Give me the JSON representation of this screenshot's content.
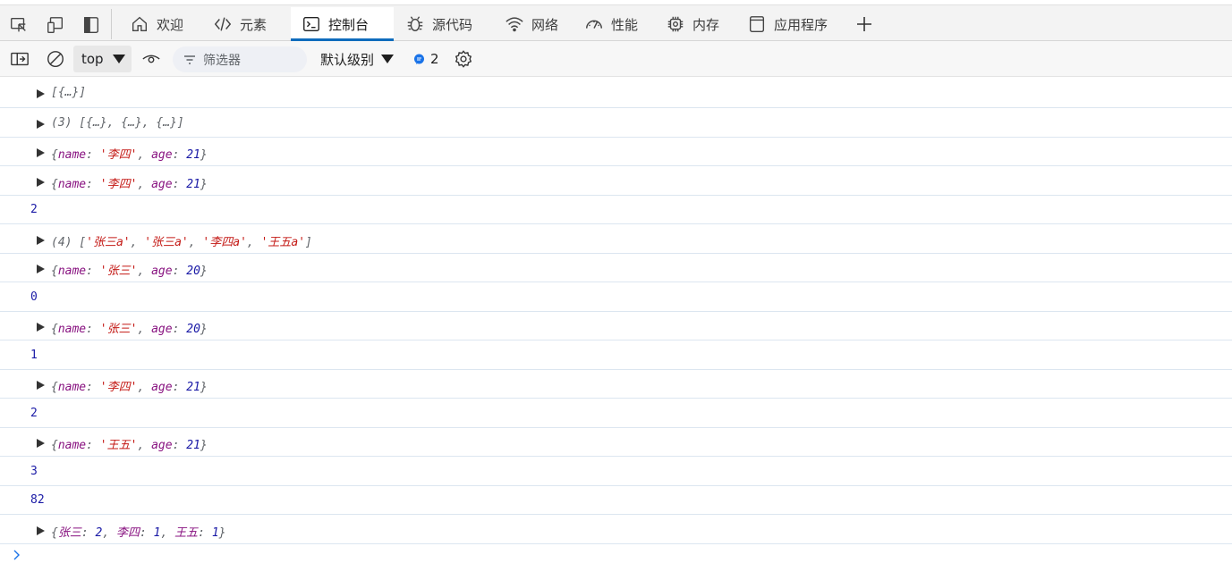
{
  "tabs": [
    {
      "label": "欢迎",
      "icon": "home-icon"
    },
    {
      "label": "元素",
      "icon": "code-icon"
    },
    {
      "label": "控制台",
      "icon": "console-icon"
    },
    {
      "label": "源代码",
      "icon": "bug-icon"
    },
    {
      "label": "网络",
      "icon": "wifi-icon"
    },
    {
      "label": "性能",
      "icon": "gauge-icon"
    },
    {
      "label": "内存",
      "icon": "chip-icon"
    },
    {
      "label": "应用程序",
      "icon": "window-icon"
    }
  ],
  "active_tab": "控制台",
  "accent_color": "#0f6cbd",
  "toolbar": {
    "context": "top",
    "filter_placeholder": "筛选器",
    "levels_label": "默认级别",
    "issues_count": "2"
  },
  "console": {
    "rows": [
      {
        "type": "object",
        "parts": [
          [
            "g",
            "[{…}]"
          ]
        ]
      },
      {
        "type": "object",
        "parts": [
          [
            "g",
            "(3) [{…}, {…}, {…}]"
          ]
        ]
      },
      {
        "type": "object",
        "parts": [
          [
            "g",
            "{"
          ],
          [
            "k",
            "name"
          ],
          [
            "g",
            ": "
          ],
          [
            "s",
            "'李四'"
          ],
          [
            "g",
            ", "
          ],
          [
            "k",
            "age"
          ],
          [
            "g",
            ": "
          ],
          [
            "n",
            "21"
          ],
          [
            "g",
            "}"
          ]
        ]
      },
      {
        "type": "object",
        "parts": [
          [
            "g",
            "{"
          ],
          [
            "k",
            "name"
          ],
          [
            "g",
            ": "
          ],
          [
            "s",
            "'李四'"
          ],
          [
            "g",
            ", "
          ],
          [
            "k",
            "age"
          ],
          [
            "g",
            ": "
          ],
          [
            "n",
            "21"
          ],
          [
            "g",
            "}"
          ]
        ]
      },
      {
        "type": "number",
        "value": "2"
      },
      {
        "type": "object",
        "parts": [
          [
            "g",
            "(4) ["
          ],
          [
            "s",
            "'张三a'"
          ],
          [
            "g",
            ", "
          ],
          [
            "s",
            "'张三a'"
          ],
          [
            "g",
            ", "
          ],
          [
            "s",
            "'李四a'"
          ],
          [
            "g",
            ", "
          ],
          [
            "s",
            "'王五a'"
          ],
          [
            "g",
            "]"
          ]
        ]
      },
      {
        "type": "object",
        "parts": [
          [
            "g",
            "{"
          ],
          [
            "k",
            "name"
          ],
          [
            "g",
            ": "
          ],
          [
            "s",
            "'张三'"
          ],
          [
            "g",
            ", "
          ],
          [
            "k",
            "age"
          ],
          [
            "g",
            ": "
          ],
          [
            "n",
            "20"
          ],
          [
            "g",
            "}"
          ]
        ]
      },
      {
        "type": "number",
        "value": "0"
      },
      {
        "type": "object",
        "parts": [
          [
            "g",
            "{"
          ],
          [
            "k",
            "name"
          ],
          [
            "g",
            ": "
          ],
          [
            "s",
            "'张三'"
          ],
          [
            "g",
            ", "
          ],
          [
            "k",
            "age"
          ],
          [
            "g",
            ": "
          ],
          [
            "n",
            "20"
          ],
          [
            "g",
            "}"
          ]
        ]
      },
      {
        "type": "number",
        "value": "1"
      },
      {
        "type": "object",
        "parts": [
          [
            "g",
            "{"
          ],
          [
            "k",
            "name"
          ],
          [
            "g",
            ": "
          ],
          [
            "s",
            "'李四'"
          ],
          [
            "g",
            ", "
          ],
          [
            "k",
            "age"
          ],
          [
            "g",
            ": "
          ],
          [
            "n",
            "21"
          ],
          [
            "g",
            "}"
          ]
        ]
      },
      {
        "type": "number",
        "value": "2"
      },
      {
        "type": "object",
        "parts": [
          [
            "g",
            "{"
          ],
          [
            "k",
            "name"
          ],
          [
            "g",
            ": "
          ],
          [
            "s",
            "'王五'"
          ],
          [
            "g",
            ", "
          ],
          [
            "k",
            "age"
          ],
          [
            "g",
            ": "
          ],
          [
            "n",
            "21"
          ],
          [
            "g",
            "}"
          ]
        ]
      },
      {
        "type": "number",
        "value": "3"
      },
      {
        "type": "number",
        "value": "82"
      },
      {
        "type": "object",
        "parts": [
          [
            "g",
            "{"
          ],
          [
            "k",
            "张三"
          ],
          [
            "g",
            ": "
          ],
          [
            "n",
            "2"
          ],
          [
            "g",
            ", "
          ],
          [
            "k",
            "李四"
          ],
          [
            "g",
            ": "
          ],
          [
            "n",
            "1"
          ],
          [
            "g",
            ", "
          ],
          [
            "k",
            "王五"
          ],
          [
            "g",
            ": "
          ],
          [
            "n",
            "1"
          ],
          [
            "g",
            "}"
          ]
        ]
      }
    ]
  }
}
